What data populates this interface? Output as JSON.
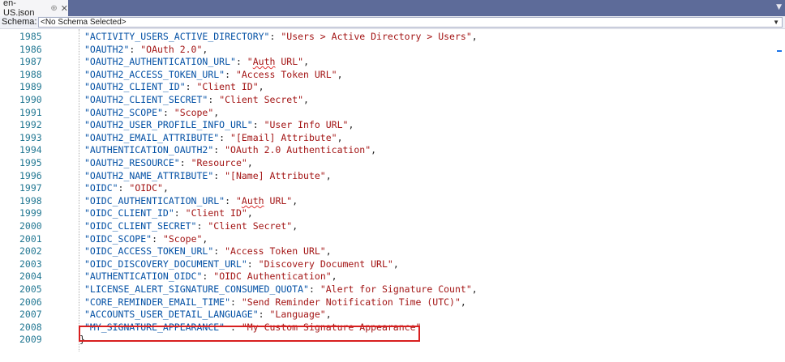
{
  "tab": {
    "label": "en-US.json",
    "pin_icon": "pin-icon",
    "close_icon": "close-icon"
  },
  "schema": {
    "label": "Schema:",
    "value": "<No Schema Selected>"
  },
  "lines": [
    {
      "n": "1985",
      "key": "\"ACTIVITY_USERS_ACTIVE_DIRECTORY\"",
      "sep": ": ",
      "val": "\"Users > Active Directory > Users\"",
      "end": ","
    },
    {
      "n": "1986",
      "key": "\"OAUTH2\"",
      "sep": ": ",
      "val": "\"OAuth 2.0\"",
      "end": ","
    },
    {
      "n": "1987",
      "key": "\"OAUTH2_AUTHENTICATION_URL\"",
      "sep": ": ",
      "val": "\"Auth URL\"",
      "end": ","
    },
    {
      "n": "1988",
      "key": "\"OAUTH2_ACCESS_TOKEN_URL\"",
      "sep": ": ",
      "val": "\"Access Token URL\"",
      "end": ","
    },
    {
      "n": "1989",
      "key": "\"OAUTH2_CLIENT_ID\"",
      "sep": ": ",
      "val": "\"Client ID\"",
      "end": ","
    },
    {
      "n": "1990",
      "key": "\"OAUTH2_CLIENT_SECRET\"",
      "sep": ": ",
      "val": "\"Client Secret\"",
      "end": ","
    },
    {
      "n": "1991",
      "key": "\"OAUTH2_SCOPE\"",
      "sep": ": ",
      "val": "\"Scope\"",
      "end": ","
    },
    {
      "n": "1992",
      "key": "\"OAUTH2_USER_PROFILE_INFO_URL\"",
      "sep": ": ",
      "val": "\"User Info URL\"",
      "end": ","
    },
    {
      "n": "1993",
      "key": "\"OAUTH2_EMAIL_ATTRIBUTE\"",
      "sep": ": ",
      "val": "\"[Email] Attribute\"",
      "end": ","
    },
    {
      "n": "1994",
      "key": "\"AUTHENTICATION_OAUTH2\"",
      "sep": ": ",
      "val": "\"OAuth 2.0 Authentication\"",
      "end": ","
    },
    {
      "n": "1995",
      "key": "\"OAUTH2_RESOURCE\"",
      "sep": ": ",
      "val": "\"Resource\"",
      "end": ","
    },
    {
      "n": "1996",
      "key": "\"OAUTH2_NAME_ATTRIBUTE\"",
      "sep": ": ",
      "val": "\"[Name] Attribute\"",
      "end": ","
    },
    {
      "n": "1997",
      "key": "\"OIDC\"",
      "sep": ": ",
      "val": "\"OIDC\"",
      "end": ","
    },
    {
      "n": "1998",
      "key": "\"OIDC_AUTHENTICATION_URL\"",
      "sep": ": ",
      "val": "\"Auth URL\"",
      "end": ","
    },
    {
      "n": "1999",
      "key": "\"OIDC_CLIENT_ID\"",
      "sep": ": ",
      "val": "\"Client ID\"",
      "end": ","
    },
    {
      "n": "2000",
      "key": "\"OIDC_CLIENT_SECRET\"",
      "sep": ": ",
      "val": "\"Client Secret\"",
      "end": ","
    },
    {
      "n": "2001",
      "key": "\"OIDC_SCOPE\"",
      "sep": ": ",
      "val": "\"Scope\"",
      "end": ","
    },
    {
      "n": "2002",
      "key": "\"OIDC_ACCESS_TOKEN_URL\"",
      "sep": ": ",
      "val": "\"Access Token URL\"",
      "end": ","
    },
    {
      "n": "2003",
      "key": "\"OIDC_DISCOVERY_DOCUMENT_URL\"",
      "sep": ": ",
      "val": "\"Discovery Document URL\"",
      "end": ","
    },
    {
      "n": "2004",
      "key": "\"AUTHENTICATION_OIDC\"",
      "sep": ": ",
      "val": "\"OIDC Authentication\"",
      "end": ","
    },
    {
      "n": "2005",
      "key": "\"LICENSE_ALERT_SIGNATURE_CONSUMED_QUOTA\"",
      "sep": ": ",
      "val": "\"Alert for Signature Count\"",
      "end": ","
    },
    {
      "n": "2006",
      "key": "\"CORE_REMINDER_EMAIL_TIME\"",
      "sep": ": ",
      "val": "\"Send Reminder Notification Time (UTC)\"",
      "end": ","
    },
    {
      "n": "2007",
      "key": "\"ACCOUNTS_USER_DETAIL_LANGUAGE\"",
      "sep": ": ",
      "val": "\"Language\"",
      "end": ","
    },
    {
      "n": "2008",
      "key": "\"MY_SIGNATURE_APPEARANCE\"",
      "sep": " : ",
      "val": "\"My Custom Signature Appearance\"",
      "end": ""
    },
    {
      "n": "2009",
      "key": "",
      "sep": "",
      "val": "",
      "end": "}"
    }
  ]
}
